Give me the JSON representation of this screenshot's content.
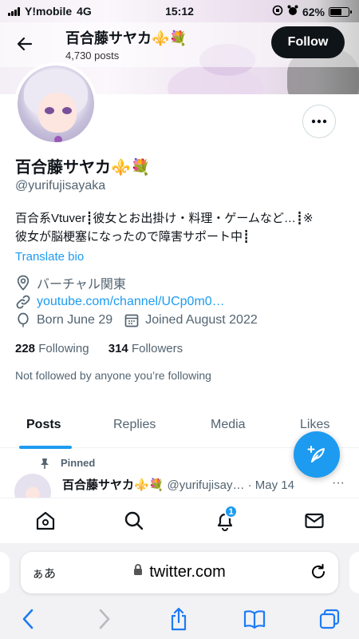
{
  "status_bar": {
    "carrier": "Y!mobile",
    "network": "4G",
    "time": "15:12",
    "battery": "62%",
    "battery_level": 0.62
  },
  "header": {
    "title": "百合藤サヤカ⚜️💐",
    "posts_count": "4,730 posts",
    "follow_label": "Follow"
  },
  "profile": {
    "name": "百合藤サヤカ⚜️💐",
    "handle": "@yurifujisayaka",
    "bio_line1": "百合系Vtuver┋彼女とお出掛け・料理・ゲームなど…┋※",
    "bio_line2": "彼女が脳梗塞になったので障害サポート中┋",
    "translate_label": "Translate bio",
    "location": "バーチャル関東",
    "link": "youtube.com/channel/UCp0m0…",
    "born": "Born June 29",
    "joined": "Joined August 2022",
    "following_count": "228",
    "following_label": "Following",
    "followers_count": "314",
    "followers_label": "Followers",
    "not_followed": "Not followed by anyone you’re following"
  },
  "tabs": [
    {
      "label": "Posts",
      "active": true
    },
    {
      "label": "Replies",
      "active": false
    },
    {
      "label": "Media",
      "active": false
    },
    {
      "label": "Likes",
      "active": false
    }
  ],
  "post": {
    "pinned_label": "Pinned",
    "author": "百合藤サヤカ⚜️💐",
    "handle_date": "@yurifujisay… · May 14",
    "more": "···"
  },
  "bottom_nav": {
    "icons": [
      "home-icon",
      "search-icon",
      "bell-icon",
      "mail-icon"
    ],
    "notification_badge": "1"
  },
  "safari": {
    "text_size_label": "ぁあ",
    "url": "twitter.com"
  },
  "colors": {
    "accent": "#1d9bf0",
    "text": "#0f1419",
    "secondary": "#536471"
  }
}
